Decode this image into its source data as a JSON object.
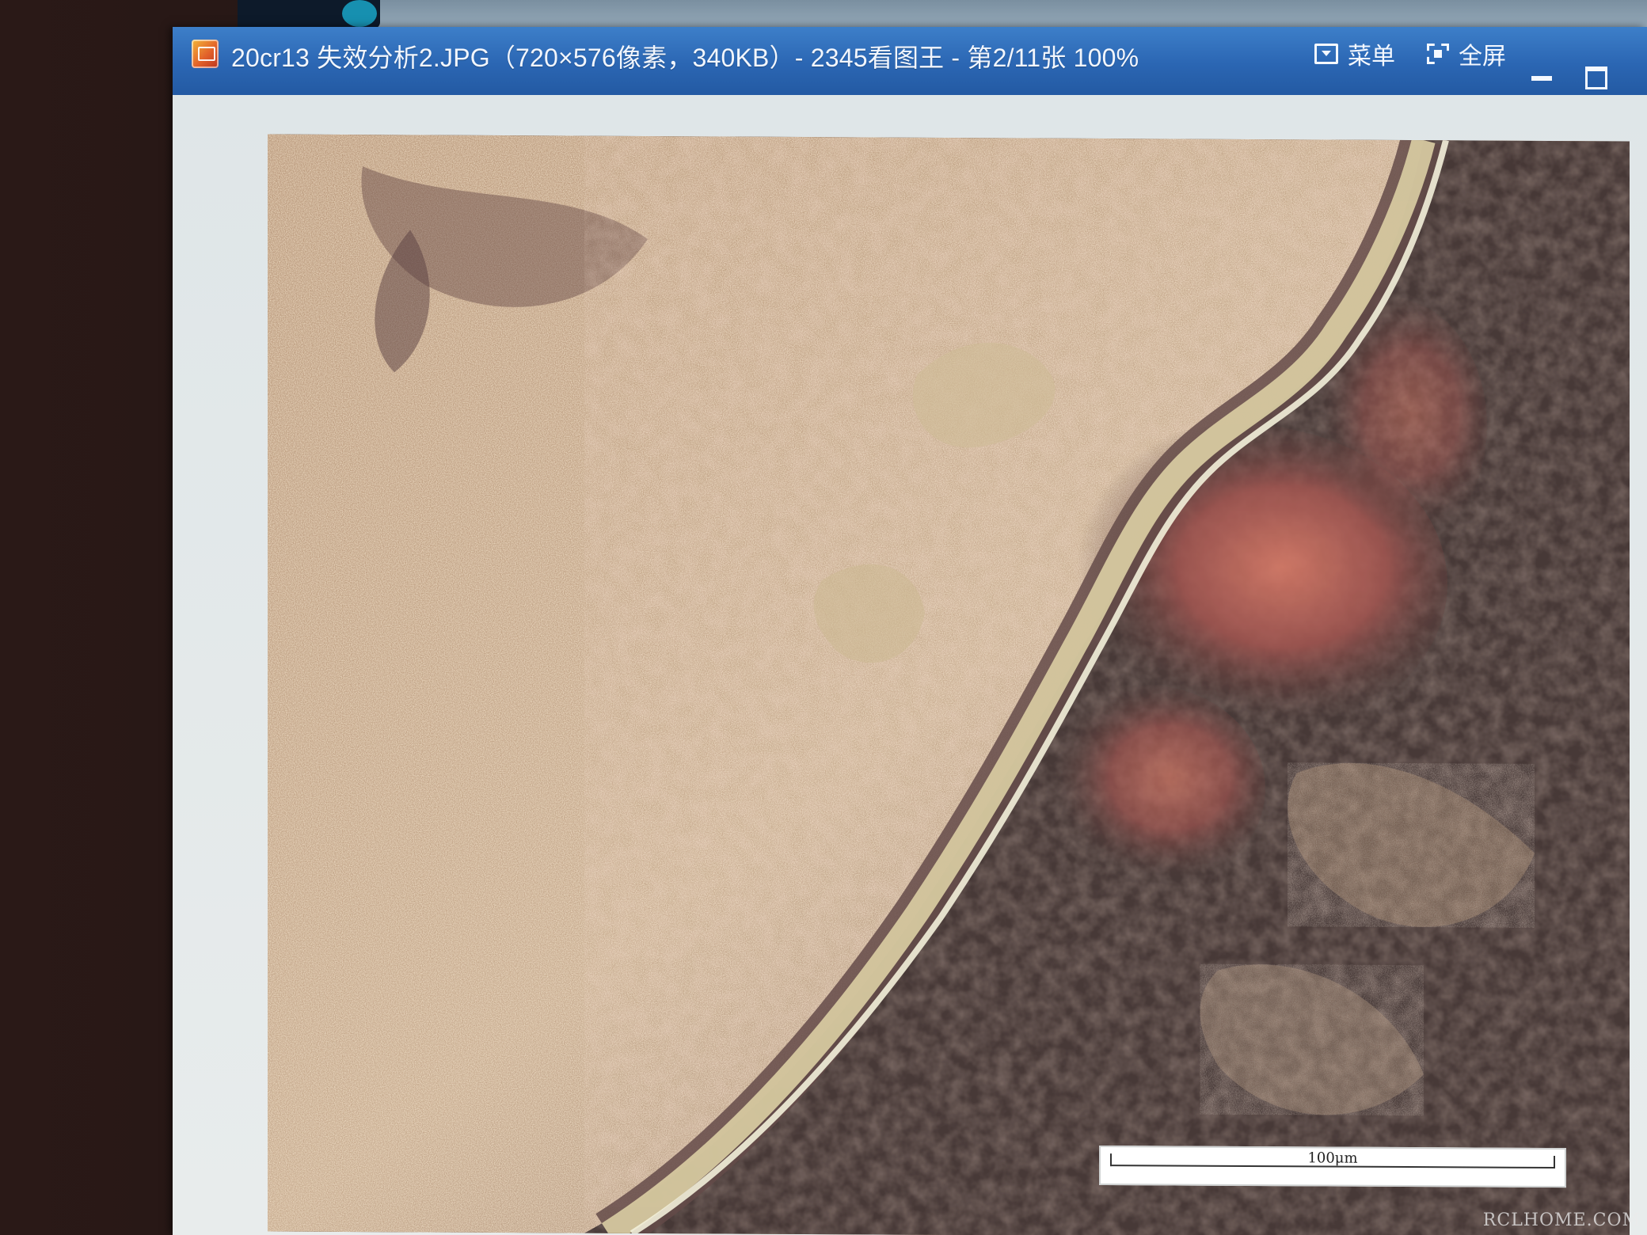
{
  "window": {
    "title": "20cr13 失效分析2.JPG（720×576像素，340KB）- 2345看图王 - 第2/11张 100%",
    "icon": "image-viewer-app-icon"
  },
  "titlebar_buttons": {
    "menu_label": "菜单",
    "fullscreen_label": "全屏",
    "menu_icon": "dropdown-menu-icon",
    "fullscreen_icon": "fullscreen-icon",
    "minimize_icon": "minimize-icon",
    "maximize_icon": "maximize-icon"
  },
  "image": {
    "scale_label": "100μm"
  },
  "watermark": "RCLHOME.COM",
  "colors": {
    "titlebar": "#2b66b3",
    "matrix": "#b99a7a",
    "oxide_layer": "#d6c79a",
    "dark_region": "#3a2a26",
    "rust_red": "#c5665a"
  }
}
